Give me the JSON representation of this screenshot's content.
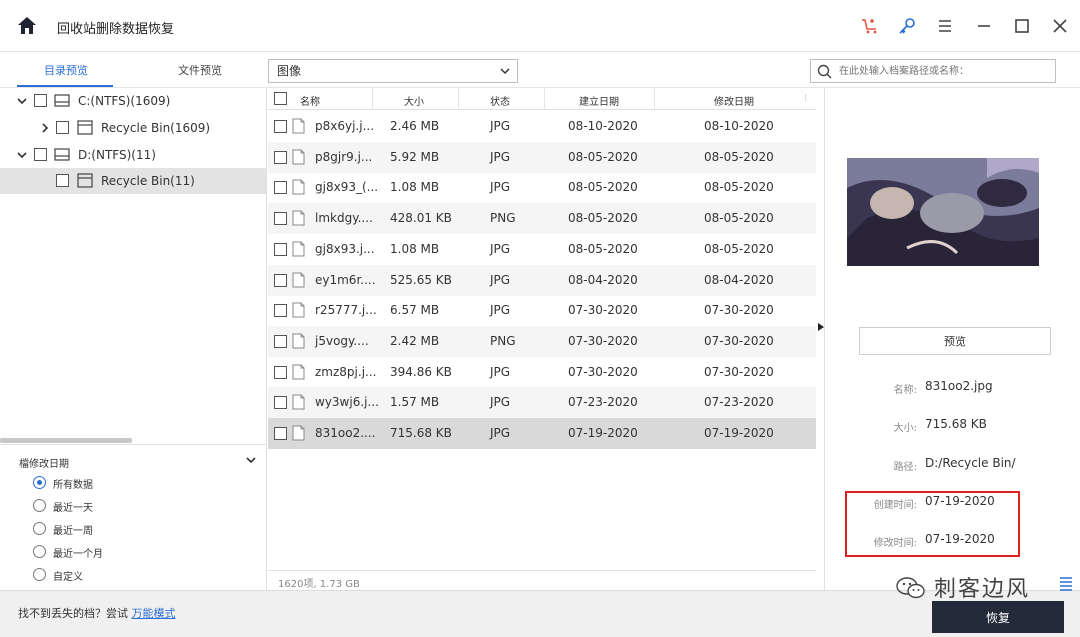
{
  "app": {
    "title": "回收站删除数据恢复"
  },
  "tabs": [
    {
      "label": "目录预览",
      "active": true
    },
    {
      "label": "文件预览",
      "active": false
    }
  ],
  "filter": {
    "selected": "图像"
  },
  "search": {
    "placeholder": "在此处输入档案路径或名称："
  },
  "tree": [
    {
      "label": "C:(NTFS)(1609)",
      "expanded": true,
      "level": 0,
      "icon": "drive-icon"
    },
    {
      "label": "Recycle Bin(1609)",
      "expanded": false,
      "level": 1,
      "icon": "recycle-bin-icon"
    },
    {
      "label": "D:(NTFS)(11)",
      "expanded": true,
      "level": 0,
      "icon": "drive-icon"
    },
    {
      "label": "Recycle Bin(11)",
      "expanded": false,
      "level": 1,
      "icon": "recycle-bin-icon",
      "selected": true
    }
  ],
  "date_filter": {
    "title": "檔修改日期",
    "options": [
      {
        "label": "所有数据",
        "checked": true
      },
      {
        "label": "最近一天",
        "checked": false
      },
      {
        "label": "最近一周",
        "checked": false
      },
      {
        "label": "最近一个月",
        "checked": false
      },
      {
        "label": "自定义",
        "checked": false
      }
    ]
  },
  "table": {
    "columns": [
      "名称",
      "大小",
      "状态",
      "建立日期",
      "修改日期"
    ],
    "rows": [
      {
        "name": "p8x6yj.j...",
        "size": "2.46 MB",
        "status": "JPG",
        "created": "08-10-2020",
        "modified": "08-10-2020"
      },
      {
        "name": "p8gjr9.j...",
        "size": "5.92 MB",
        "status": "JPG",
        "created": "08-05-2020",
        "modified": "08-05-2020"
      },
      {
        "name": "gj8x93_(...",
        "size": "1.08 MB",
        "status": "JPG",
        "created": "08-05-2020",
        "modified": "08-05-2020"
      },
      {
        "name": "lmkdgy....",
        "size": "428.01 KB",
        "status": "PNG",
        "created": "08-05-2020",
        "modified": "08-05-2020"
      },
      {
        "name": "gj8x93.j...",
        "size": "1.08 MB",
        "status": "JPG",
        "created": "08-05-2020",
        "modified": "08-05-2020"
      },
      {
        "name": "ey1m6r....",
        "size": "525.65 KB",
        "status": "JPG",
        "created": "08-04-2020",
        "modified": "08-04-2020"
      },
      {
        "name": "r25777.j...",
        "size": "6.57 MB",
        "status": "JPG",
        "created": "07-30-2020",
        "modified": "07-30-2020"
      },
      {
        "name": "j5vogy....",
        "size": "2.42 MB",
        "status": "PNG",
        "created": "07-30-2020",
        "modified": "07-30-2020"
      },
      {
        "name": "zmz8pj.j...",
        "size": "394.86 KB",
        "status": "JPG",
        "created": "07-30-2020",
        "modified": "07-30-2020"
      },
      {
        "name": "wy3wj6.j...",
        "size": "1.57 MB",
        "status": "JPG",
        "created": "07-23-2020",
        "modified": "07-23-2020"
      },
      {
        "name": "831oo2....",
        "size": "715.68 KB",
        "status": "JPG",
        "created": "07-19-2020",
        "modified": "07-19-2020",
        "selected": true
      }
    ]
  },
  "status_bar": {
    "summary": "1620项, 1.73 GB"
  },
  "preview": {
    "button_label": "预览",
    "info": [
      {
        "label": "名称:",
        "value": "831oo2.jpg"
      },
      {
        "label": "大小:",
        "value": "715.68 KB"
      },
      {
        "label": "路径:",
        "value": "D:/Recycle Bin/"
      },
      {
        "label": "创建时间:",
        "value": "07-19-2020"
      },
      {
        "label": "修改时间:",
        "value": "07-19-2020"
      }
    ]
  },
  "bottom": {
    "help_text": "找不到丢失的档？尝试",
    "help_link": "万能模式",
    "recover_label": "恢复"
  },
  "watermark": {
    "text": "刺客边风"
  },
  "colors": {
    "accent": "#2a6fd6",
    "dark_button": "#232b3a",
    "highlight": "#e02020",
    "cart_icon": "#e8543a"
  }
}
